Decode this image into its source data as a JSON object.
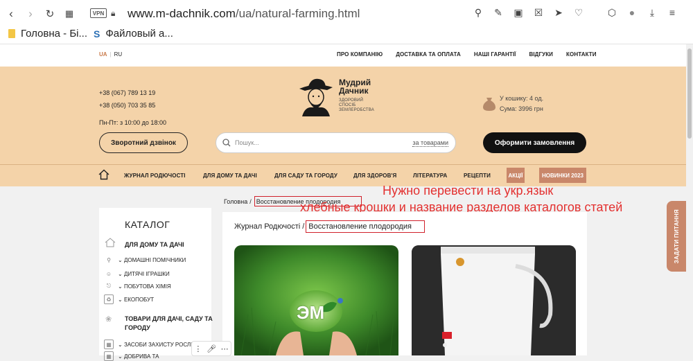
{
  "browser": {
    "vpn_label": "VPN",
    "url_domain": "www.m-dachnik.com",
    "url_path": "/ua/natural-farming.html",
    "bookmarks": [
      {
        "label": "Головна - Бі..."
      },
      {
        "label": "Файловый а..."
      }
    ]
  },
  "site": {
    "lang": {
      "ua": "UA",
      "sep": "|",
      "ru": "RU"
    },
    "top_menu": [
      "ПРО КОМПАНІЮ",
      "ДОСТАВКА ТА ОПЛАТА",
      "НАШІ ГАРАНТІЇ",
      "ВІДГУКИ",
      "КОНТАКТИ"
    ],
    "phones": [
      "+38 (067) 789 13 19",
      "+38 (050) 703 35 85"
    ],
    "hours": "Пн-Пт: з 10:00 до 18:00",
    "callback_label": "Зворотний дзвінок",
    "logo": {
      "title_line1": "Мудрий",
      "title_line2": "Дачник",
      "sub_line1": "ЗДОРОВИЙ",
      "sub_line2": "СПОСІБ",
      "sub_line3": "ЗЕМЛЕРОБСТВА"
    },
    "search": {
      "placeholder": "Пошук...",
      "scope": "за товарами"
    },
    "cart": {
      "count_text": "У кошику: 4 од.",
      "sum_text": "Сума: 3996 грн"
    },
    "order_button": "Оформити замовлення",
    "main_menu": [
      "ЖУРНАЛ РОДЮЧОСТІ",
      "ДЛЯ ДОМУ ТА ДАЧІ",
      "ДЛЯ САДУ ТА ГОРОДУ",
      "ДЛЯ ЗДОРОВ'Я",
      "ЛІТЕРАТУРА",
      "РЕЦЕПТИ"
    ],
    "badges": [
      "АКЦІЇ",
      "НОВИНКИ 2023"
    ],
    "breadcrumb": {
      "home": "Головна",
      "sep": "/",
      "current": "Восстановление плодородия"
    },
    "annotation": {
      "line1": "Нужно перевести на укр.язык",
      "line2": "хлебные крошки и название разделов каталогов статей"
    },
    "catalog": {
      "title": "КАТАЛОГ",
      "section1": "ДЛЯ ДОМУ ТА ДАЧІ",
      "items1": [
        "ДОМАШНІ ПОМІЧНИКИ",
        "ДИТЯЧІ ІГРАШКИ",
        "ПОБУТОВА ХІМІЯ",
        "ЕКОПОБУТ"
      ],
      "section2_line1": "ТОВАРИ ДЛЯ ДАЧІ, САДУ ТА",
      "section2_line2": "ГОРОДУ",
      "items2": [
        "ЗАСОБИ ЗАХИСТУ РОСЛИН",
        "ДОБРИВА ТА"
      ]
    },
    "content": {
      "title_prefix": "Журнал Родючості /",
      "title_current": "Восстановление плодородия",
      "image1_text": "ЭМ"
    },
    "side_tab": "ЗАДАТИ ПИТАННЯ"
  }
}
